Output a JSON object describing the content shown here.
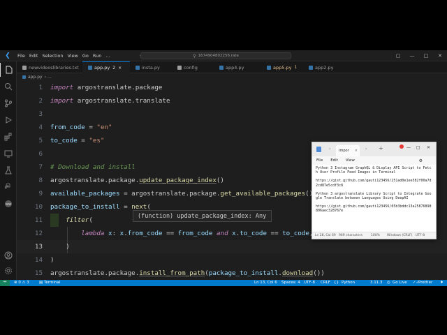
{
  "titlebar": {
    "menus": [
      "File",
      "Edit",
      "Selection",
      "View",
      "Go",
      "Run",
      "…"
    ],
    "search": "1674904802256.rate"
  },
  "tabs": [
    {
      "label": "newvideoslibraries.txt",
      "color": "#9d9d9d",
      "modified": ""
    },
    {
      "label": "app.py",
      "color": "#3572a5",
      "modified": "2"
    },
    {
      "label": "insta.py",
      "color": "#3572a5",
      "modified": ""
    },
    {
      "label": "config",
      "color": "#9d9d9d",
      "modified": ""
    },
    {
      "label": "app4.py",
      "color": "#3572a5",
      "modified": ""
    },
    {
      "label": "app5.py",
      "color": "#3572a5",
      "modified": "1"
    },
    {
      "label": "app2.py",
      "color": "#3572a5",
      "modified": ""
    }
  ],
  "breadcrumb": {
    "file": "app.py",
    "rest": "› …"
  },
  "editor": {
    "line_numbers": [
      "1",
      "2",
      "3",
      "4",
      "5",
      "6",
      "7",
      "8",
      "9",
      "10",
      "11",
      "12",
      "13",
      "14",
      "15"
    ],
    "current_line": 13
  },
  "hover": {
    "text": "(function) update_package_index: Any"
  },
  "notepad": {
    "tab_label": "Impor",
    "menu": [
      "File",
      "Edit",
      "View"
    ],
    "body": [
      "Python 3 Instagram GraphQL & Display API Script to Fetch User Profile Feed Images in Terminal",
      "https://gist.github.com/gauti123456/251ad0e1ee582f00a7d2cd87e5cdf3c8",
      "Python 3 argostranslate Library Script to Integrate Google Translate between Languages Using DeepAI",
      "https://gist.github.com/gauti123456/05b3bddc13a25876898806aec328767e"
    ],
    "status": {
      "pos": "Ln 28, Col 69",
      "chars": "969 characters",
      "zoom": "100%",
      "eol": "Windows (CRLF)",
      "enc": "UTF-8"
    }
  },
  "statusbar": {
    "remote": "↔",
    "problems": "⊗ 0 ⚠ 3",
    "terminal": "Terminal",
    "position": "Ln 13, Col 6",
    "spaces": "Spaces: 4",
    "encoding": "UTF-8",
    "eol": "CRLF",
    "language": "Python",
    "interpreter": "3.11.3",
    "golive": "Go Live",
    "prettier": "Prettier"
  }
}
